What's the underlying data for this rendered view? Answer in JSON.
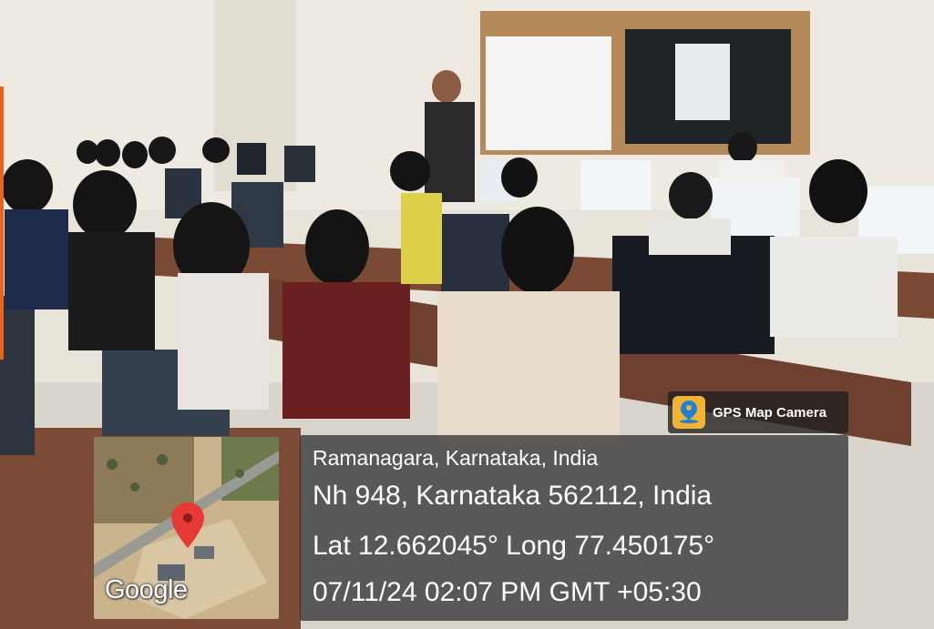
{
  "photo": {
    "description_name": "classroom-workshop-photo"
  },
  "badge": {
    "icon": "map-pin-icon",
    "label": "GPS Map Camera"
  },
  "map": {
    "logo_text": "Google",
    "pin_icon": "map-marker-icon"
  },
  "location": {
    "city": "Ramanagara, Karnataka, India",
    "address": "Nh 948, Karnataka 562112, India",
    "coords": "Lat 12.662045° Long 77.450175°",
    "datetime": "07/11/24 02:07 PM GMT +05:30"
  },
  "colors": {
    "accent": "#e8641e",
    "overlay": "#282828",
    "pin": "#e53935"
  }
}
